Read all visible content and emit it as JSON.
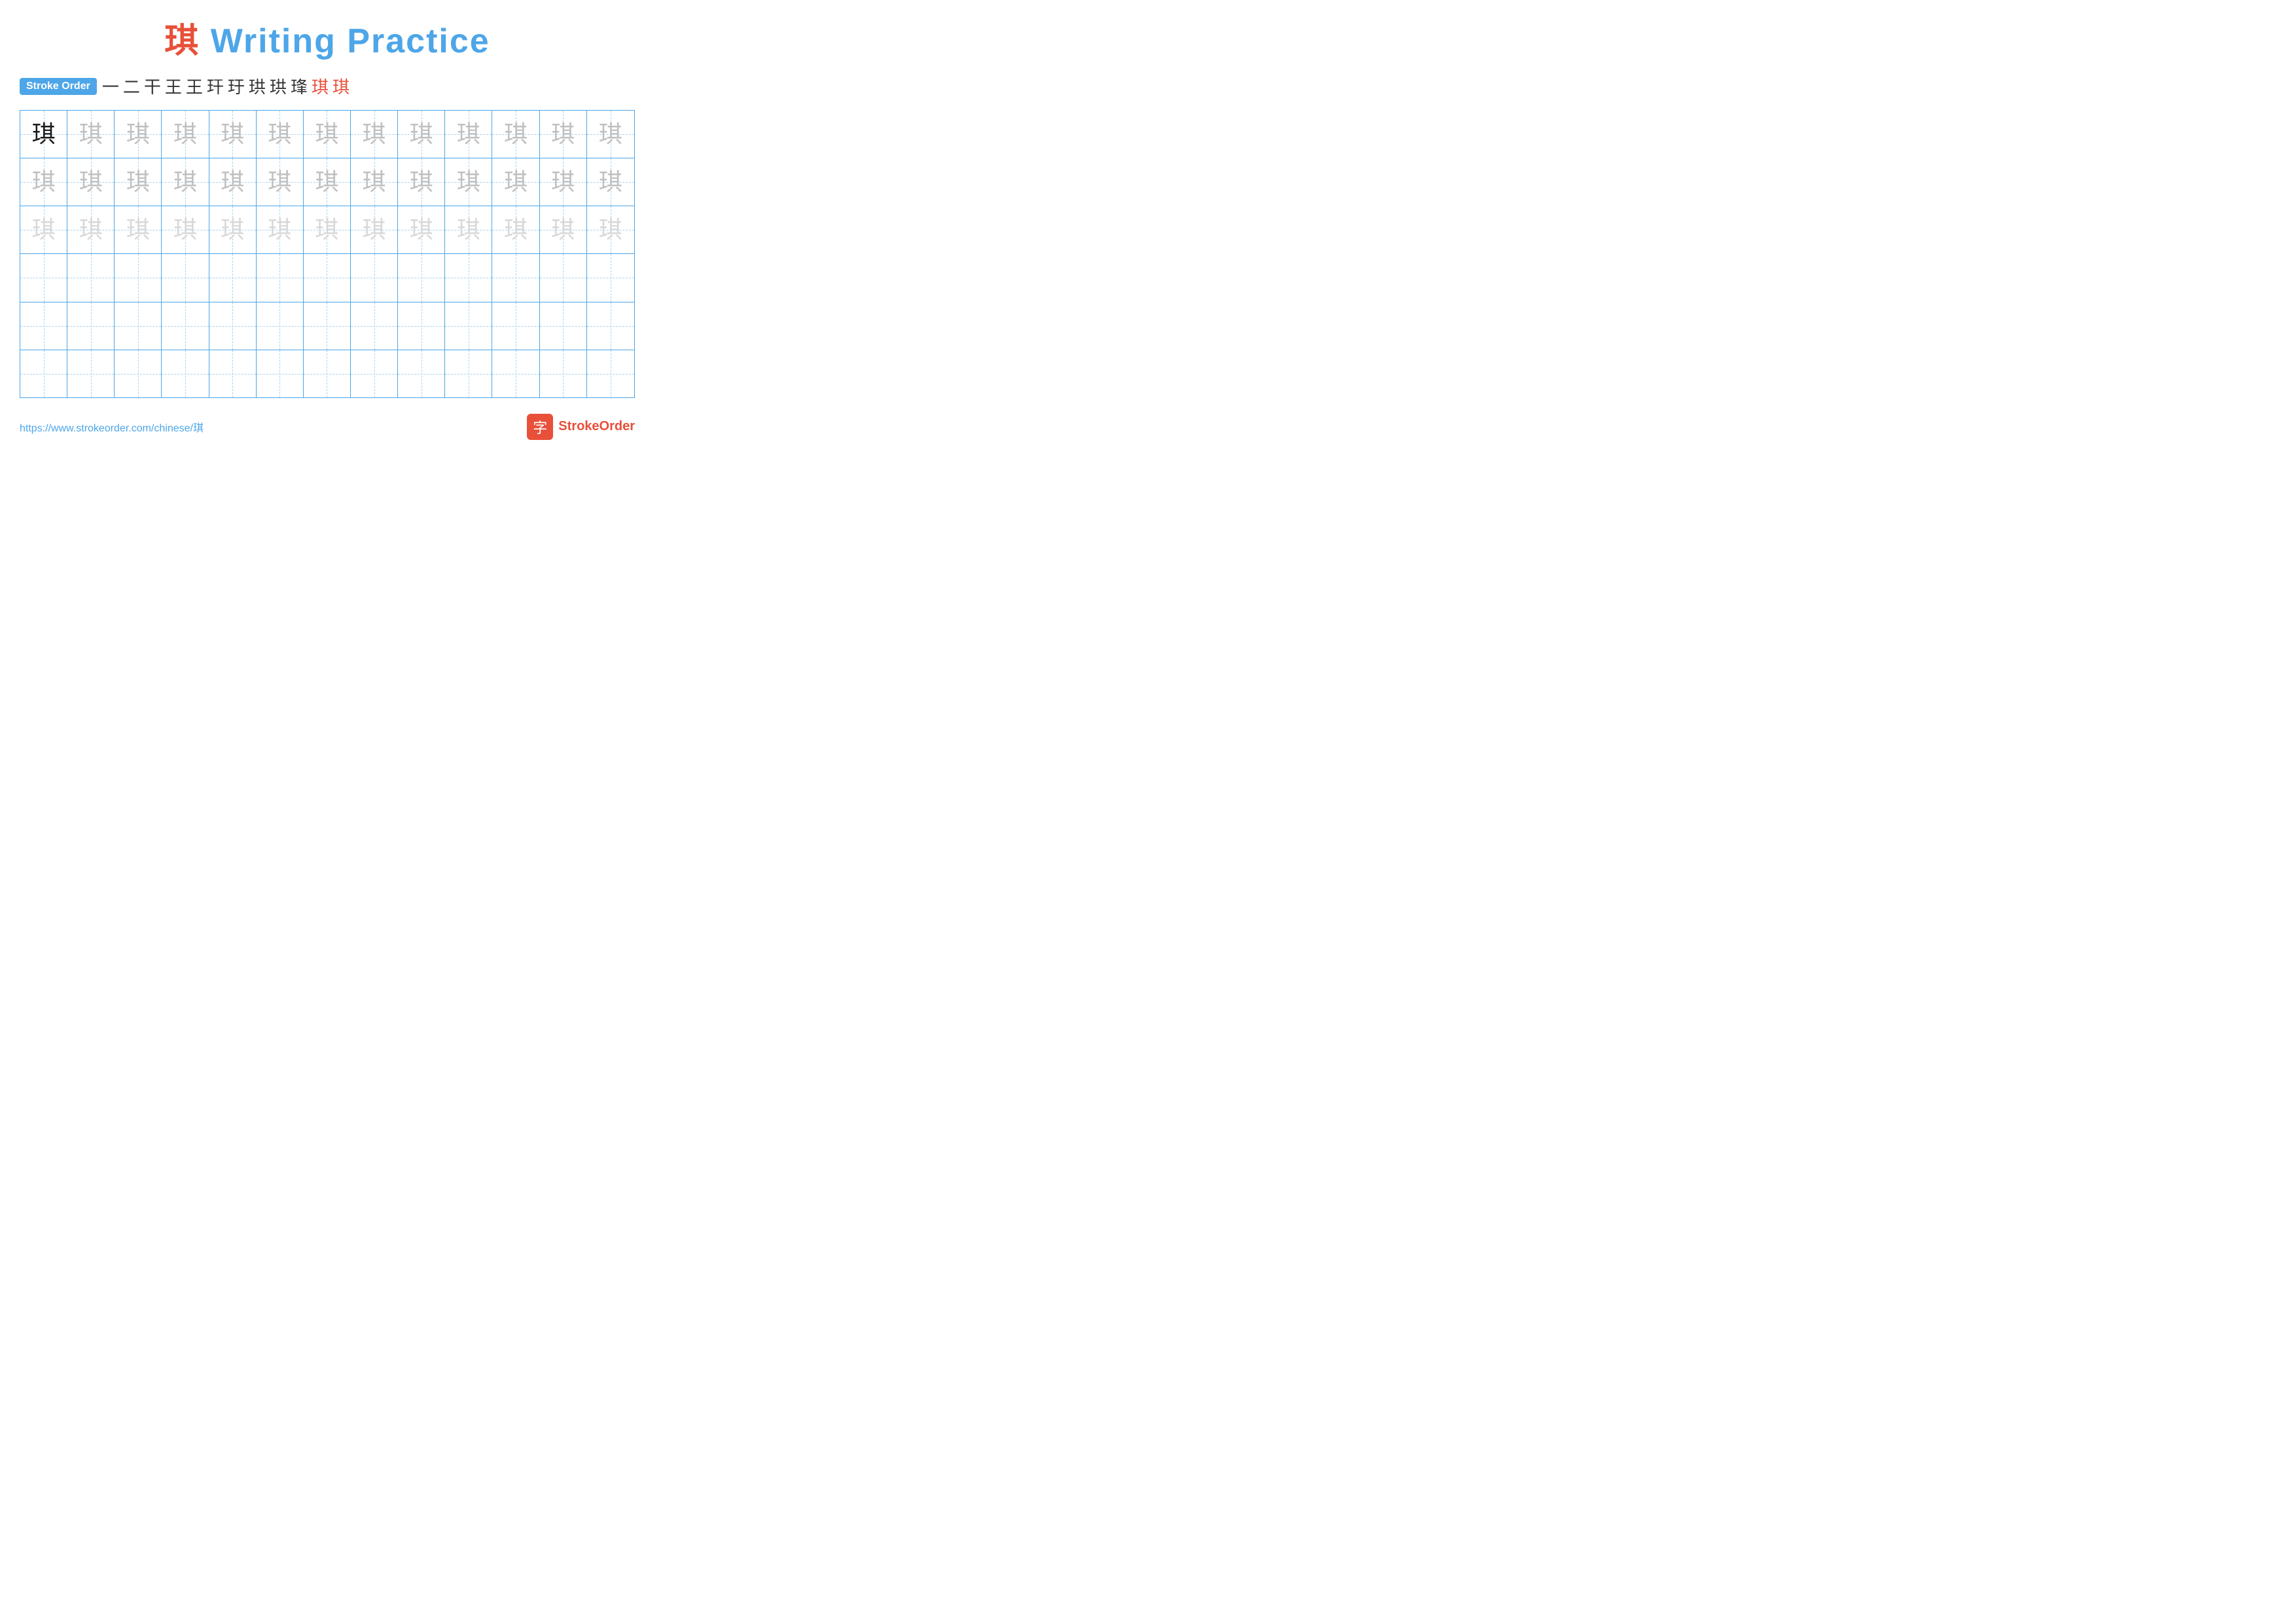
{
  "title": {
    "prefix": "琪",
    "suffix": " Writing Practice"
  },
  "stroke_order": {
    "badge_label": "Stroke Order",
    "steps": [
      "一",
      "二",
      "干",
      "王",
      "王⁻",
      "玕",
      "玗",
      "珙",
      "珙",
      "琒",
      "琪",
      "琪"
    ]
  },
  "grid": {
    "rows": 6,
    "cols": 13,
    "character": "琪",
    "row_styles": [
      [
        "dark",
        "medium-gray",
        "medium-gray",
        "medium-gray",
        "medium-gray",
        "medium-gray",
        "medium-gray",
        "medium-gray",
        "medium-gray",
        "medium-gray",
        "medium-gray",
        "medium-gray",
        "medium-gray"
      ],
      [
        "medium-gray",
        "medium-gray",
        "medium-gray",
        "medium-gray",
        "medium-gray",
        "medium-gray",
        "medium-gray",
        "medium-gray",
        "medium-gray",
        "medium-gray",
        "medium-gray",
        "medium-gray",
        "medium-gray"
      ],
      [
        "light-gray",
        "light-gray",
        "light-gray",
        "light-gray",
        "light-gray",
        "light-gray",
        "light-gray",
        "light-gray",
        "light-gray",
        "light-gray",
        "light-gray",
        "light-gray",
        "light-gray"
      ],
      [
        "empty",
        "empty",
        "empty",
        "empty",
        "empty",
        "empty",
        "empty",
        "empty",
        "empty",
        "empty",
        "empty",
        "empty",
        "empty"
      ],
      [
        "empty",
        "empty",
        "empty",
        "empty",
        "empty",
        "empty",
        "empty",
        "empty",
        "empty",
        "empty",
        "empty",
        "empty",
        "empty"
      ],
      [
        "empty",
        "empty",
        "empty",
        "empty",
        "empty",
        "empty",
        "empty",
        "empty",
        "empty",
        "empty",
        "empty",
        "empty",
        "empty"
      ]
    ]
  },
  "footer": {
    "url": "https://www.strokeorder.com/chinese/琪",
    "logo_text": "StrokeOrder",
    "logo_icon": "字"
  }
}
